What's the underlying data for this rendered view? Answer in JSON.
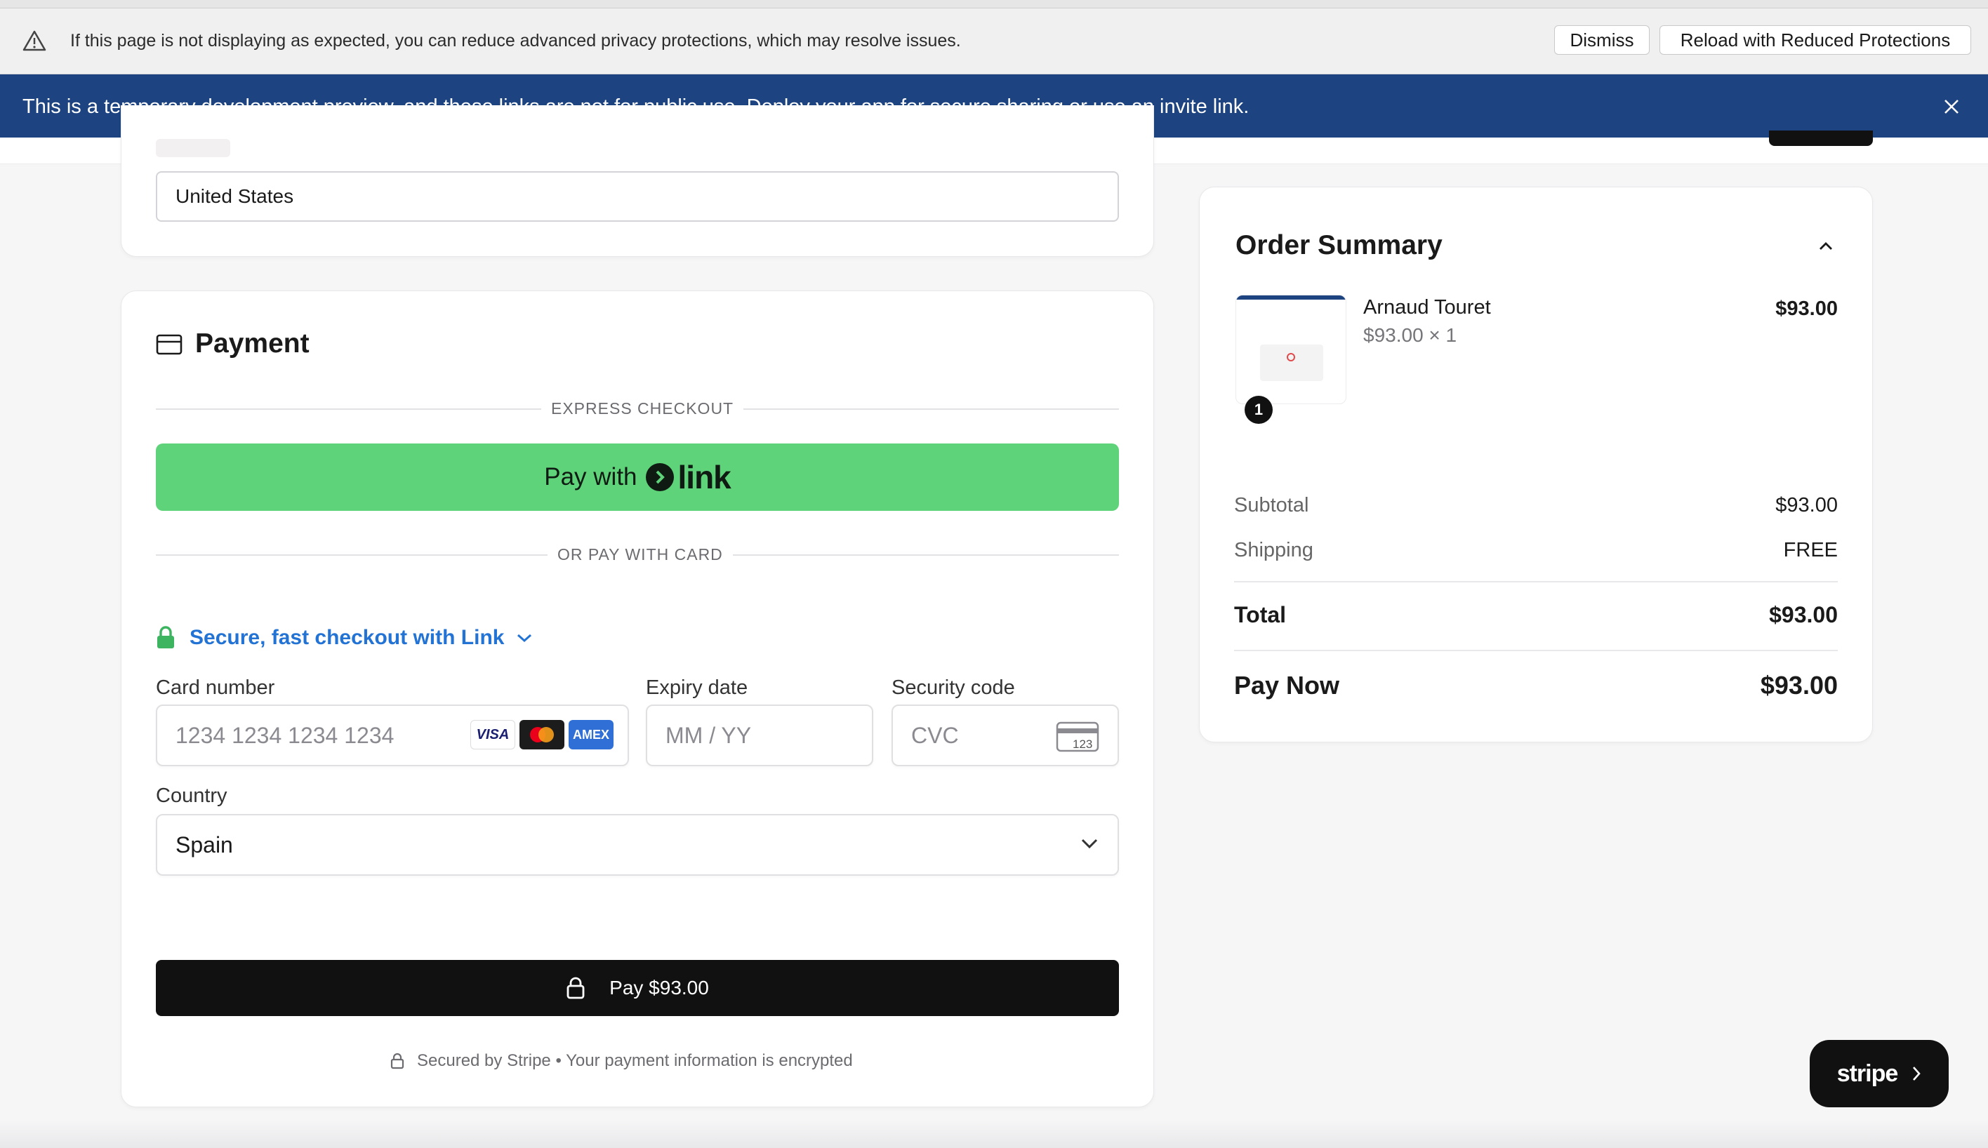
{
  "privacy_notice": {
    "message": "If this page is not displaying as expected, you can reduce advanced privacy protections, which may resolve issues.",
    "dismiss_label": "Dismiss",
    "reload_label": "Reload with Reduced Protections"
  },
  "dev_banner": {
    "text_before": "This is a temporary development preview, and these links are not for public use. ",
    "link_text": "Deploy your app",
    "text_after": " for secure sharing or use an invite link."
  },
  "address": {
    "country_value": "United States"
  },
  "payment": {
    "title": "Payment",
    "express_checkout_label": "EXPRESS CHECKOUT",
    "link_button_prefix": "Pay with",
    "link_brand": "link",
    "or_card_label": "OR PAY WITH CARD",
    "secure_link_text": "Secure, fast checkout with Link",
    "card_number_label": "Card number",
    "card_number_placeholder": "1234 1234 1234 1234",
    "expiry_label": "Expiry date",
    "expiry_placeholder": "MM / YY",
    "security_label": "Security code",
    "security_placeholder": "CVC",
    "cvc_icon_text": "123",
    "country_label": "Country",
    "country_value": "Spain",
    "card_brands": [
      "VISA",
      "mastercard",
      "AMEX"
    ],
    "pay_button_label": "Pay $93.00",
    "secured_text": "Secured by Stripe • Your payment information is encrypted"
  },
  "summary": {
    "title": "Order Summary",
    "item": {
      "name": "Arnaud Touret",
      "unit_line": "$93.00 × 1",
      "price": "$93.00",
      "quantity": "1"
    },
    "subtotal_label": "Subtotal",
    "subtotal_value": "$93.00",
    "shipping_label": "Shipping",
    "shipping_value": "FREE",
    "total_label": "Total",
    "total_value": "$93.00",
    "paynow_label": "Pay Now",
    "paynow_value": "$93.00"
  },
  "stripe_badge": {
    "label": "stripe"
  },
  "colors": {
    "banner_blue": "#1d4480",
    "link_green": "#5fd37a",
    "link_text_blue": "#2373d5"
  }
}
